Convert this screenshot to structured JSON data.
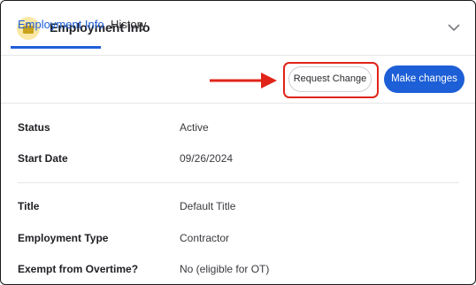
{
  "section": {
    "title": "Employment Info",
    "icon": "briefcase-icon",
    "expand_icon": "chevron-down-icon"
  },
  "tabs": [
    {
      "label": "Employment Info",
      "active": true
    },
    {
      "label": "History",
      "active": false
    }
  ],
  "actions": {
    "request_change_label": "Request Change",
    "make_changes_label": "Make changes"
  },
  "fields_group1": [
    {
      "label": "Status",
      "value": "Active"
    },
    {
      "label": "Start Date",
      "value": "09/26/2024"
    }
  ],
  "fields_group2": [
    {
      "label": "Title",
      "value": "Default Title"
    },
    {
      "label": "Employment Type",
      "value": "Contractor"
    },
    {
      "label": "Exempt from Overtime?",
      "value": "No (eligible for OT)"
    }
  ],
  "colors": {
    "accent": "#1f5fd9",
    "primary_button": "#1d5fd6",
    "annotation_red": "#e0241a",
    "icon_bg": "#fbe7a6",
    "icon_fg": "#c9a21a"
  }
}
